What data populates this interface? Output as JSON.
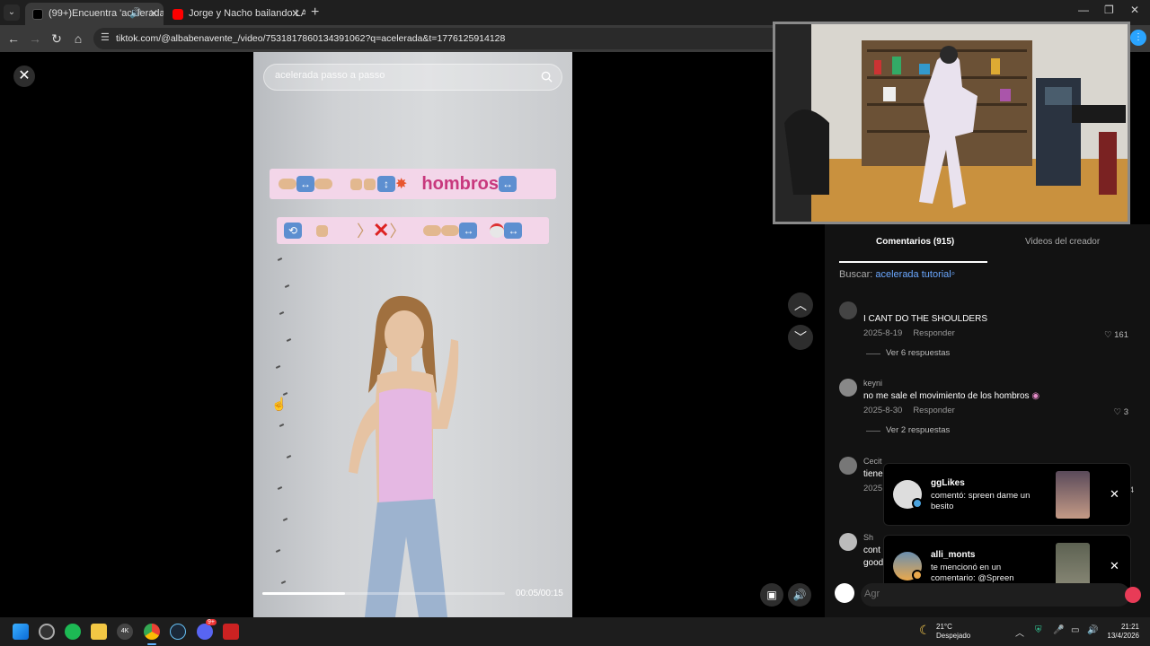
{
  "browser": {
    "tabs": [
      {
        "title": "(99+)Encuentra 'acelerada' ",
        "active": true
      },
      {
        "title": "Jorge y Nacho bailando LA MÁ",
        "active": false
      }
    ],
    "url": "tiktok.com/@albabenavente_/video/7531817860134391062?q=acelerada&t=1776125914128"
  },
  "video": {
    "search_placeholder": "acelerada passo a passo",
    "overlay_word": "hombros",
    "current_time": "00:05/00:15",
    "progress": 0.34
  },
  "comments_panel": {
    "tab_comments": "Comentarios (915)",
    "tab_creator": "Videos del creador",
    "search_prefix": "Buscar:",
    "search_term": "acelerada tutorial",
    "reply_label": "Responder",
    "comments": [
      {
        "user": "",
        "text": "I CANT DO THE SHOULDERS",
        "date": "2025-8-19",
        "likes": "161",
        "more": "Ver 6 respuestas"
      },
      {
        "user": "keyni",
        "text": "no me sale el movimiento de los hombros",
        "date": "2025-8-30",
        "likes": "3",
        "more": "Ver 2 respuestas"
      },
      {
        "user": "Cecit",
        "text": "tiene",
        "date": "2025",
        "likes": "74",
        "more": ""
      },
      {
        "user": "Sh",
        "text": "cont",
        "text2": "good",
        "date": "",
        "likes": "",
        "more": ""
      }
    ],
    "input_placeholder": "Agr"
  },
  "notifications": [
    {
      "user": "ggLikes",
      "text": "comentó: spreen dame un besito"
    },
    {
      "user": "alli_monts",
      "text": "te mencionó en un comentario: @Spreen"
    }
  ],
  "taskbar": {
    "temperature": "21°C",
    "weather": "Despejado",
    "time": "21:21",
    "date": "13/4/2026",
    "badges": {
      "discord": "9+"
    }
  },
  "colors": {
    "accent_link": "#6aa7ff",
    "tiktok_red": "#e83b57",
    "overlay_text": "#c8387d"
  }
}
